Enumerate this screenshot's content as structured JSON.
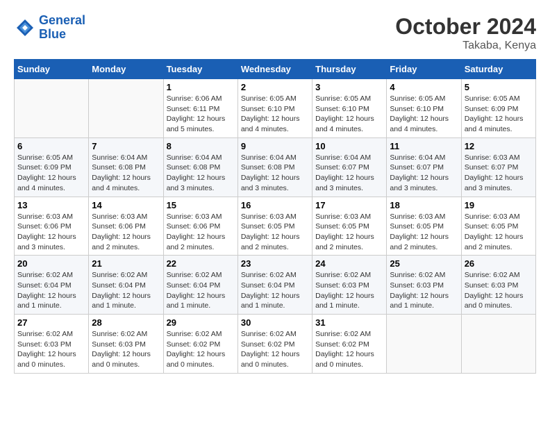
{
  "header": {
    "logo_line1": "General",
    "logo_line2": "Blue",
    "month": "October 2024",
    "location": "Takaba, Kenya"
  },
  "weekdays": [
    "Sunday",
    "Monday",
    "Tuesday",
    "Wednesday",
    "Thursday",
    "Friday",
    "Saturday"
  ],
  "weeks": [
    [
      {
        "day": "",
        "info": ""
      },
      {
        "day": "",
        "info": ""
      },
      {
        "day": "1",
        "info": "Sunrise: 6:06 AM\nSunset: 6:11 PM\nDaylight: 12 hours and 5 minutes."
      },
      {
        "day": "2",
        "info": "Sunrise: 6:05 AM\nSunset: 6:10 PM\nDaylight: 12 hours and 4 minutes."
      },
      {
        "day": "3",
        "info": "Sunrise: 6:05 AM\nSunset: 6:10 PM\nDaylight: 12 hours and 4 minutes."
      },
      {
        "day": "4",
        "info": "Sunrise: 6:05 AM\nSunset: 6:10 PM\nDaylight: 12 hours and 4 minutes."
      },
      {
        "day": "5",
        "info": "Sunrise: 6:05 AM\nSunset: 6:09 PM\nDaylight: 12 hours and 4 minutes."
      }
    ],
    [
      {
        "day": "6",
        "info": "Sunrise: 6:05 AM\nSunset: 6:09 PM\nDaylight: 12 hours and 4 minutes."
      },
      {
        "day": "7",
        "info": "Sunrise: 6:04 AM\nSunset: 6:08 PM\nDaylight: 12 hours and 4 minutes."
      },
      {
        "day": "8",
        "info": "Sunrise: 6:04 AM\nSunset: 6:08 PM\nDaylight: 12 hours and 3 minutes."
      },
      {
        "day": "9",
        "info": "Sunrise: 6:04 AM\nSunset: 6:08 PM\nDaylight: 12 hours and 3 minutes."
      },
      {
        "day": "10",
        "info": "Sunrise: 6:04 AM\nSunset: 6:07 PM\nDaylight: 12 hours and 3 minutes."
      },
      {
        "day": "11",
        "info": "Sunrise: 6:04 AM\nSunset: 6:07 PM\nDaylight: 12 hours and 3 minutes."
      },
      {
        "day": "12",
        "info": "Sunrise: 6:03 AM\nSunset: 6:07 PM\nDaylight: 12 hours and 3 minutes."
      }
    ],
    [
      {
        "day": "13",
        "info": "Sunrise: 6:03 AM\nSunset: 6:06 PM\nDaylight: 12 hours and 3 minutes."
      },
      {
        "day": "14",
        "info": "Sunrise: 6:03 AM\nSunset: 6:06 PM\nDaylight: 12 hours and 2 minutes."
      },
      {
        "day": "15",
        "info": "Sunrise: 6:03 AM\nSunset: 6:06 PM\nDaylight: 12 hours and 2 minutes."
      },
      {
        "day": "16",
        "info": "Sunrise: 6:03 AM\nSunset: 6:05 PM\nDaylight: 12 hours and 2 minutes."
      },
      {
        "day": "17",
        "info": "Sunrise: 6:03 AM\nSunset: 6:05 PM\nDaylight: 12 hours and 2 minutes."
      },
      {
        "day": "18",
        "info": "Sunrise: 6:03 AM\nSunset: 6:05 PM\nDaylight: 12 hours and 2 minutes."
      },
      {
        "day": "19",
        "info": "Sunrise: 6:03 AM\nSunset: 6:05 PM\nDaylight: 12 hours and 2 minutes."
      }
    ],
    [
      {
        "day": "20",
        "info": "Sunrise: 6:02 AM\nSunset: 6:04 PM\nDaylight: 12 hours and 1 minute."
      },
      {
        "day": "21",
        "info": "Sunrise: 6:02 AM\nSunset: 6:04 PM\nDaylight: 12 hours and 1 minute."
      },
      {
        "day": "22",
        "info": "Sunrise: 6:02 AM\nSunset: 6:04 PM\nDaylight: 12 hours and 1 minute."
      },
      {
        "day": "23",
        "info": "Sunrise: 6:02 AM\nSunset: 6:04 PM\nDaylight: 12 hours and 1 minute."
      },
      {
        "day": "24",
        "info": "Sunrise: 6:02 AM\nSunset: 6:03 PM\nDaylight: 12 hours and 1 minute."
      },
      {
        "day": "25",
        "info": "Sunrise: 6:02 AM\nSunset: 6:03 PM\nDaylight: 12 hours and 1 minute."
      },
      {
        "day": "26",
        "info": "Sunrise: 6:02 AM\nSunset: 6:03 PM\nDaylight: 12 hours and 0 minutes."
      }
    ],
    [
      {
        "day": "27",
        "info": "Sunrise: 6:02 AM\nSunset: 6:03 PM\nDaylight: 12 hours and 0 minutes."
      },
      {
        "day": "28",
        "info": "Sunrise: 6:02 AM\nSunset: 6:03 PM\nDaylight: 12 hours and 0 minutes."
      },
      {
        "day": "29",
        "info": "Sunrise: 6:02 AM\nSunset: 6:02 PM\nDaylight: 12 hours and 0 minutes."
      },
      {
        "day": "30",
        "info": "Sunrise: 6:02 AM\nSunset: 6:02 PM\nDaylight: 12 hours and 0 minutes."
      },
      {
        "day": "31",
        "info": "Sunrise: 6:02 AM\nSunset: 6:02 PM\nDaylight: 12 hours and 0 minutes."
      },
      {
        "day": "",
        "info": ""
      },
      {
        "day": "",
        "info": ""
      }
    ]
  ]
}
